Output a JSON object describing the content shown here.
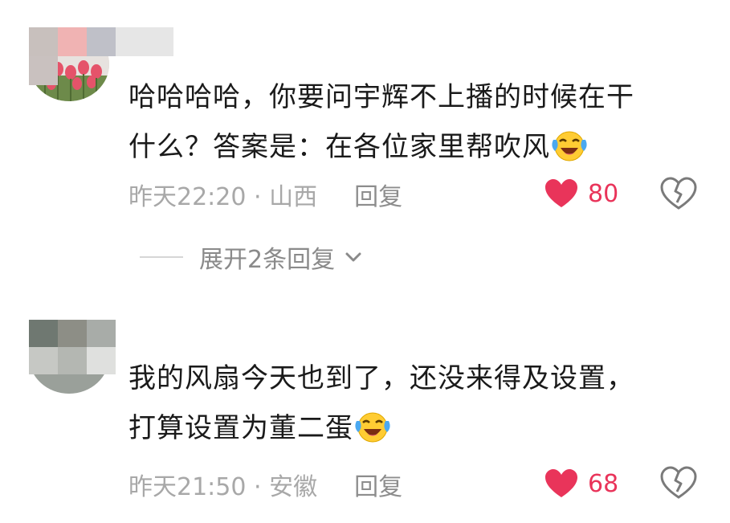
{
  "comments": [
    {
      "text_line1": "哈哈哈哈，你要问宇辉不上播的时候在干",
      "text_line2": "什么？答案是：在各位家里帮吹风",
      "emoji": "laughing-crying-emoji",
      "time_location": "昨天22:20 · 山西",
      "reply_label": "回复",
      "like_count": "80",
      "expand_replies": "展开2条回复"
    },
    {
      "text_line1": "我的风扇今天也到了，还没来得及设置，",
      "text_line2": "打算设置为董二蛋",
      "emoji": "laughing-crying-emoji",
      "time_location": "昨天21:50 · 安徽",
      "reply_label": "回复",
      "like_count": "68"
    }
  ],
  "colors": {
    "like_red": "#e9345a",
    "meta_gray": "#a8a8a8",
    "text_dark": "#1a1a1a"
  },
  "icons": {
    "like": "heart-icon",
    "dislike": "broken-heart-icon",
    "expand": "chevron-down-icon"
  }
}
